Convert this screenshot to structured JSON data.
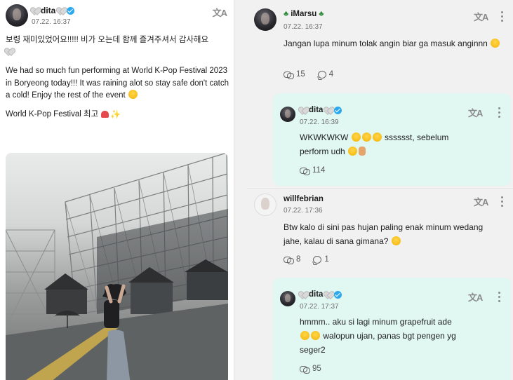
{
  "post": {
    "author": "dita",
    "date": "07.22. 16:37",
    "translate_icon": "translate-icon",
    "lines": {
      "korean": "보령 재미있었어요!!!!! 비가 오는데 함께 즐겨주셔서 감사해요",
      "english": "We had so much fun performing at World K-Pop Festival 2023 in Boryeong today!!! It was raining alot so stay safe don't catch a cold! Enjoy the rest of the event",
      "festival": "World K-Pop Festival 최고"
    }
  },
  "comments": [
    {
      "author": "iMarsu",
      "date": "07.22. 16:37",
      "text": "Jangan lupa minum tolak angin biar ga masuk anginnn",
      "reposts": "15",
      "replies": "4",
      "reply": {
        "author": "dita",
        "date": "07.22. 16:39",
        "text_a": "WKWKWKW",
        "text_b": "sssssst, sebelum",
        "text_c": "perform udh",
        "reposts": "114"
      }
    },
    {
      "author": "willfebrian",
      "date": "07.22. 17:36",
      "text": "Btw kalo di sini pas hujan paling enak minum wedang jahe, kalau di sana gimana?",
      "reposts": "8",
      "replies": "1",
      "reply": {
        "author": "dita",
        "date": "07.22. 17:37",
        "text_a": "hmmm.. aku si lagi minum grapefruit ade",
        "text_b": "walopun ujan, panas bgt pengen yg",
        "text_c": "seger2",
        "reposts": "95"
      }
    }
  ],
  "colors": {
    "reply_bg": "#e1f7f1",
    "verified": "#2aa9f0"
  }
}
